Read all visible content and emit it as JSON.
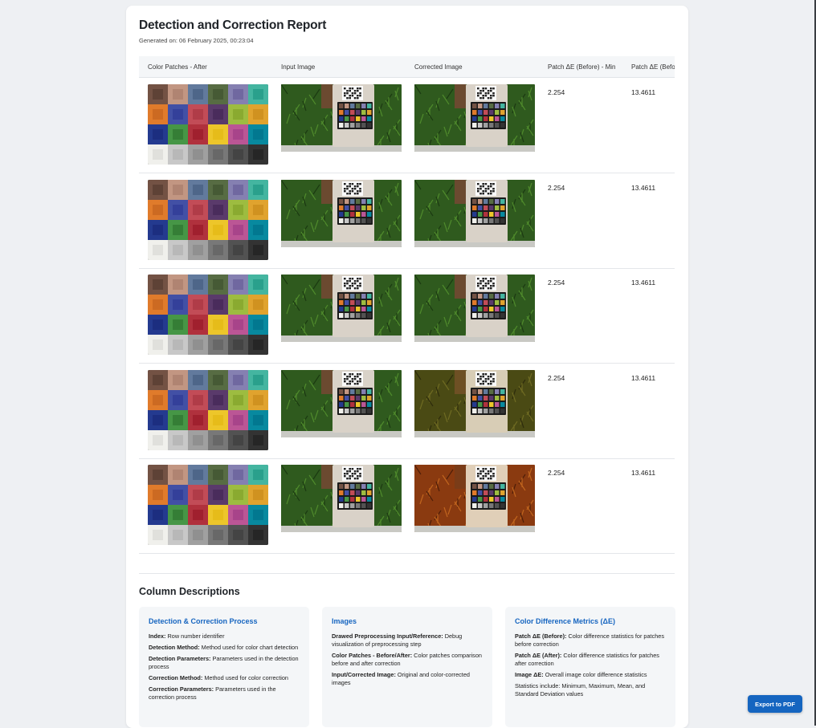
{
  "report": {
    "title": "Detection and Correction Report",
    "generated": "Generated on: 06 February 2025, 00:23:04"
  },
  "table": {
    "headers": [
      "Color Patches - After",
      "Input Image",
      "Corrected Image",
      "Patch ΔE (Before) - Min",
      "Patch ΔE (Before) - Max"
    ],
    "rows": [
      {
        "min": "2.254",
        "max": "13.4611",
        "tone": "normal"
      },
      {
        "min": "2.254",
        "max": "13.4611",
        "tone": "normal"
      },
      {
        "min": "2.254",
        "max": "13.4611",
        "tone": "normal"
      },
      {
        "min": "2.254",
        "max": "13.4611",
        "tone": "olive"
      },
      {
        "min": "2.254",
        "max": "13.4611",
        "tone": "orange"
      }
    ]
  },
  "patch_colors": {
    "outer": [
      "#735244",
      "#c29682",
      "#627a9d",
      "#576c43",
      "#8580b1",
      "#44b5a0",
      "#e07b2b",
      "#4250a5",
      "#c24c57",
      "#5a3a6b",
      "#9dbc40",
      "#e0a32e",
      "#243a8f",
      "#469646",
      "#b0313d",
      "#edc62a",
      "#bb5695",
      "#08899f",
      "#f0f0ec",
      "#c8c8c8",
      "#a0a0a0",
      "#787878",
      "#525252",
      "#333333"
    ],
    "inner": [
      "#5e4236",
      "#b08472",
      "#4e6689",
      "#465a35",
      "#7068a0",
      "#2aa08c",
      "#cc6a22",
      "#34409a",
      "#b03c48",
      "#4a2c5c",
      "#8aaa30",
      "#d09220",
      "#1c2e80",
      "#357e36",
      "#a0202e",
      "#e6bc1a",
      "#a8448a",
      "#027890",
      "#e0e0dc",
      "#b8b8b8",
      "#909090",
      "#686868",
      "#444444",
      "#262626"
    ]
  },
  "descriptions": {
    "title": "Column Descriptions",
    "cards": [
      {
        "title": "Detection & Correction Process",
        "items": [
          {
            "term": "Index:",
            "text": " Row number identifier"
          },
          {
            "term": "Detection Method:",
            "text": " Method used for color chart detection"
          },
          {
            "term": "Detection Parameters:",
            "text": " Parameters used in the detection process"
          },
          {
            "term": "Correction Method:",
            "text": " Method used for color correction"
          },
          {
            "term": "Correction Parameters:",
            "text": " Parameters used in the correction process"
          }
        ]
      },
      {
        "title": "Images",
        "items": [
          {
            "term": "Drawed Preprocessing Input/Reference:",
            "text": " Debug visualization of preprocessing step"
          },
          {
            "term": "Color Patches - Before/After:",
            "text": " Color patches comparison before and after correction"
          },
          {
            "term": "Input/Corrected Image:",
            "text": " Original and color-corrected images"
          }
        ]
      },
      {
        "title": "Color Difference Metrics (ΔE)",
        "items": [
          {
            "term": "Patch ΔE (Before):",
            "text": " Color difference statistics for patches before correction"
          },
          {
            "term": "Patch ΔE (After):",
            "text": " Color difference statistics for patches after correction"
          },
          {
            "term": "Image ΔE:",
            "text": " Overall image color difference statistics"
          },
          {
            "term": "",
            "text": "Statistics include: Minimum, Maximum, Mean, and Standard Deviation values"
          }
        ]
      }
    ]
  },
  "export_button": "Export to PDF"
}
